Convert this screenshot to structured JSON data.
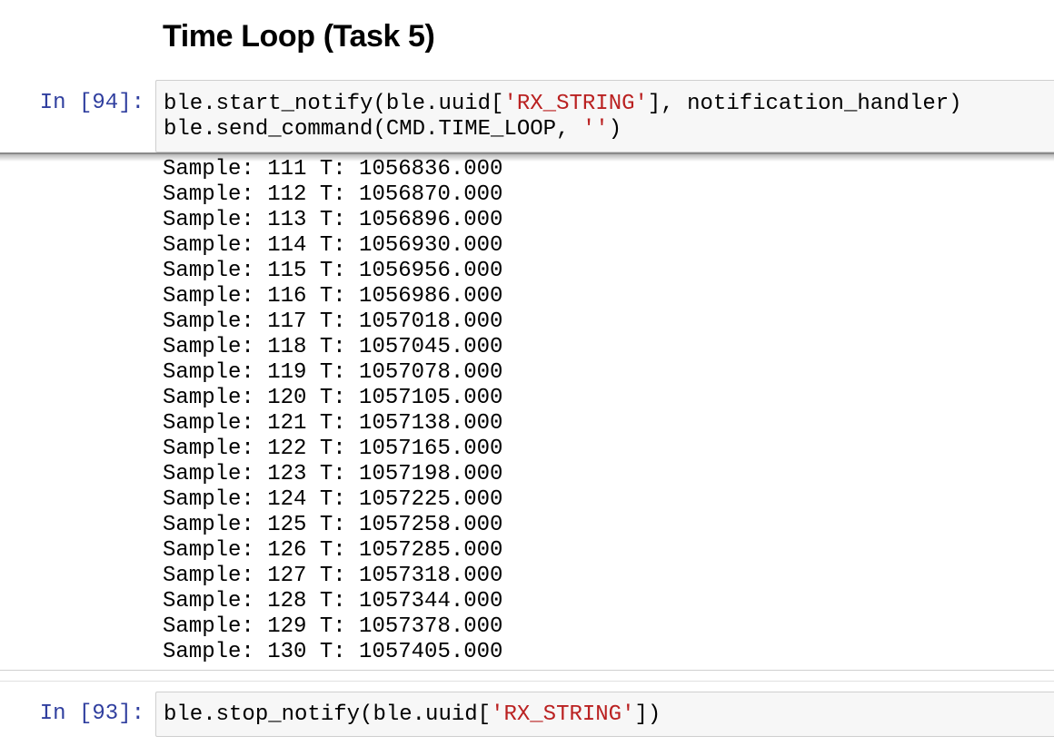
{
  "heading": "Time Loop (Task 5)",
  "cells": [
    {
      "prompt": "In [94]:",
      "code": {
        "line1": {
          "a": "ble.start_notify(ble.uuid[",
          "s1": "'RX_STRING'",
          "b": "], notification_handler)"
        },
        "line2": {
          "a": "ble.send_command(CMD.TIME_LOOP, ",
          "s1": "''",
          "b": ")"
        }
      },
      "output": [
        "Sample: 111 T: 1056836.000",
        "Sample: 112 T: 1056870.000",
        "Sample: 113 T: 1056896.000",
        "Sample: 114 T: 1056930.000",
        "Sample: 115 T: 1056956.000",
        "Sample: 116 T: 1056986.000",
        "Sample: 117 T: 1057018.000",
        "Sample: 118 T: 1057045.000",
        "Sample: 119 T: 1057078.000",
        "Sample: 120 T: 1057105.000",
        "Sample: 121 T: 1057138.000",
        "Sample: 122 T: 1057165.000",
        "Sample: 123 T: 1057198.000",
        "Sample: 124 T: 1057225.000",
        "Sample: 125 T: 1057258.000",
        "Sample: 126 T: 1057285.000",
        "Sample: 127 T: 1057318.000",
        "Sample: 128 T: 1057344.000",
        "Sample: 129 T: 1057378.000",
        "Sample: 130 T: 1057405.000"
      ]
    },
    {
      "prompt": "In [93]:",
      "code": {
        "line1": {
          "a": "ble.stop_notify(ble.uuid[",
          "s1": "'RX_STRING'",
          "b": "])"
        }
      }
    }
  ],
  "colors": {
    "prompt": "#303f9f",
    "string_literal": "#ba2121",
    "code_background": "#f7f7f7"
  }
}
